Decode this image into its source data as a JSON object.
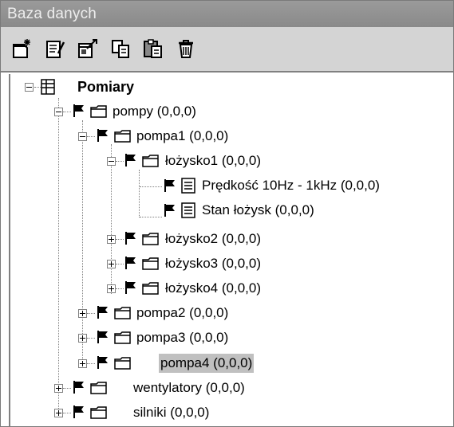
{
  "window": {
    "title": "Baza danych"
  },
  "toolbar": {
    "buttons": [
      {
        "icon": "new-item-icon"
      },
      {
        "icon": "edit-icon"
      },
      {
        "icon": "properties-icon"
      },
      {
        "icon": "copy-icon"
      },
      {
        "icon": "paste-icon"
      },
      {
        "icon": "delete-icon"
      }
    ]
  },
  "tree": {
    "root": "Pomiary",
    "pompy": "pompy (0,0,0)",
    "pompa1": "pompa1 (0,0,0)",
    "lozysko1": "łożysko1 (0,0,0)",
    "predkosc": "Prędkość 10Hz - 1kHz (0,0,0)",
    "stan": "Stan łożysk  (0,0,0)",
    "lozysko2": "łożysko2 (0,0,0)",
    "lozysko3": "łożysko3 (0,0,0)",
    "lozysko4": "łożysko4 (0,0,0)",
    "pompa2": "pompa2 (0,0,0)",
    "pompa3": "pompa3 (0,0,0)",
    "pompa4": "pompa4 (0,0,0)",
    "wentylatory": "wentylatory (0,0,0)",
    "silniki": "silniki (0,0,0)"
  },
  "colors": {
    "titlebar": "#8f8f8f",
    "toolbar": "#d4d4d4",
    "selection": "#c0c0c0"
  }
}
